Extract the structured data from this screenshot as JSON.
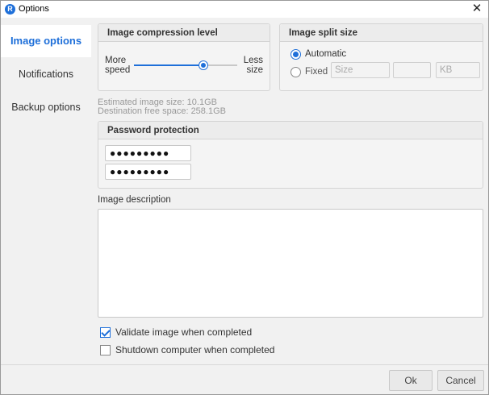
{
  "window": {
    "title": "Options",
    "app_icon_glyph": "R"
  },
  "sidebar": {
    "items": [
      {
        "label": "Image options",
        "active": true
      },
      {
        "label": "Notifications",
        "active": false
      },
      {
        "label": "Backup options",
        "active": false
      }
    ]
  },
  "compression": {
    "title": "Image compression level",
    "left_label": "More\nspeed",
    "right_label": "Less\nsize",
    "level": 0.67
  },
  "split": {
    "title": "Image split size",
    "automatic_label": "Automatic",
    "fixed_label": "Fixed",
    "selected": "automatic",
    "size_placeholder": "Size",
    "unit": "KB"
  },
  "info": {
    "estimated": "Estimated image size: 10.1GB",
    "free_space": "Destination free space: 258.1GB"
  },
  "password": {
    "title": "Password protection",
    "field1": "●●●●●●●●●",
    "field2": "●●●●●●●●●"
  },
  "description": {
    "label": "Image description",
    "value": ""
  },
  "checks": {
    "validate": {
      "label": "Validate image when completed",
      "checked": true
    },
    "shutdown": {
      "label": "Shutdown computer when completed",
      "checked": false
    }
  },
  "buttons": {
    "ok": "Ok",
    "cancel": "Cancel"
  },
  "colors": {
    "accent": "#1e6fd9"
  }
}
